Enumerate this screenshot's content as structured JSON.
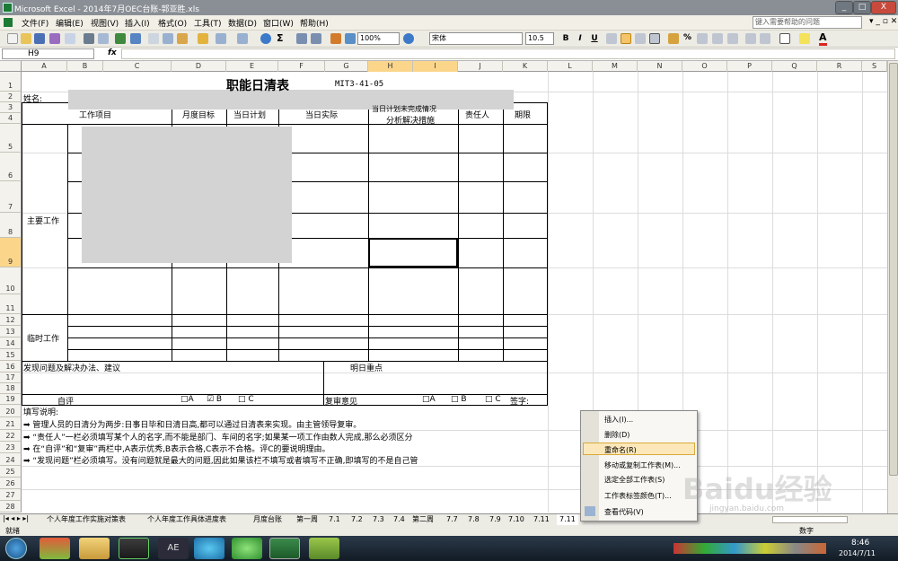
{
  "window": {
    "title": "Microsoft Excel - 2014年7月OEC台账-郭亚胜.xls",
    "help_placeholder": "键入需要帮助的问题",
    "buttons": [
      "_",
      "□",
      "X"
    ]
  },
  "menu": [
    "文件(F)",
    "编辑(E)",
    "视图(V)",
    "插入(I)",
    "格式(O)",
    "工具(T)",
    "数据(D)",
    "窗口(W)",
    "帮助(H)"
  ],
  "toolbar": {
    "zoom": "100%",
    "font_name": "宋体",
    "font_size": "10.5",
    "bold": "B",
    "italic": "I",
    "underline": "U"
  },
  "formula_bar": {
    "name_box": "H9",
    "fx": "fx",
    "content": ""
  },
  "columns": [
    "A",
    "B",
    "C",
    "D",
    "E",
    "F",
    "G",
    "H",
    "I",
    "J",
    "K",
    "L",
    "M",
    "N",
    "O",
    "P",
    "Q",
    "R",
    "S"
  ],
  "rows": [
    "1",
    "2",
    "3",
    "4",
    "5",
    "6",
    "7",
    "8",
    "9",
    "10",
    "11",
    "12",
    "13",
    "14",
    "15",
    "16",
    "17",
    "18",
    "19",
    "20",
    "21",
    "22",
    "23",
    "24",
    "25",
    "26",
    "27",
    "28"
  ],
  "sheet": {
    "title": "职能日清表",
    "code": "MIT3-41-05",
    "name_label": "姓名:",
    "headers": {
      "work_item": "工作项目",
      "monthly_goal": "月度目标",
      "daily_plan": "当日计划",
      "daily_actual": "当日实际",
      "analysis_top": "当日计划未完成情况",
      "analysis_bottom": "分析解决措施",
      "owner": "责任人",
      "deadline": "期限"
    },
    "main_work": "主要工作",
    "temp_work": "临时工作",
    "issues": "发现问题及解决办法、建议",
    "tomorrow": "明日重点",
    "self_eval": "自评",
    "eval_opts": [
      "□A",
      "☑ B",
      "□ C"
    ],
    "review": "复审意见",
    "review_opts": [
      "□A",
      "□ B",
      "□ C",
      "签字:"
    ],
    "notes_title": "填写说明:",
    "notes": [
      "➡ 管理人员的日清分为两步:日事日毕和日清日高,都可以通过日清表来实现。由主管领导复审。",
      "➡ “责任人”一栏必须填写某个人的名字,而不能是部门、车间的名字;如果某一项工作由数人完成,那么必须区分",
      "➡ 在“自评”和“复审”两栏中,A表示优秀,B表示合格,C表示不合格。评C的要说明理由。",
      "➡ “发现问题”栏必须填写。没有问题就是最大的问题,因此如果该栏不填写或者填写不正确,即填写的不是自己管"
    ]
  },
  "tabs": [
    "个人年度工作实施对策表",
    "个人年度工作具体进度表",
    "月度台账",
    "第一周",
    "7.1",
    "7.2",
    "7.3",
    "7.4",
    "第二周",
    "7.7",
    "7.8",
    "7.9",
    "7.10",
    "7.11",
    "7.11"
  ],
  "status": {
    "left": "就绪",
    "right": "数字"
  },
  "context_menu": [
    "插入(I)...",
    "删除(D)",
    "重命名(R)",
    "移动或复制工作表(M)...",
    "选定全部工作表(S)",
    "工作表标签颜色(T)...",
    "查看代码(V)"
  ],
  "context_menu_selected": "重命名(R)",
  "taskbar": {
    "time": "8:46",
    "date": "2014/7/11"
  },
  "watermark": "Baidu经验",
  "watermark_sub": "jingyan.baidu.com",
  "colors": {
    "selected_header": "#fbd68a",
    "menu_highlight": "#fbe7b9",
    "excel_green": "#1d7a34"
  }
}
